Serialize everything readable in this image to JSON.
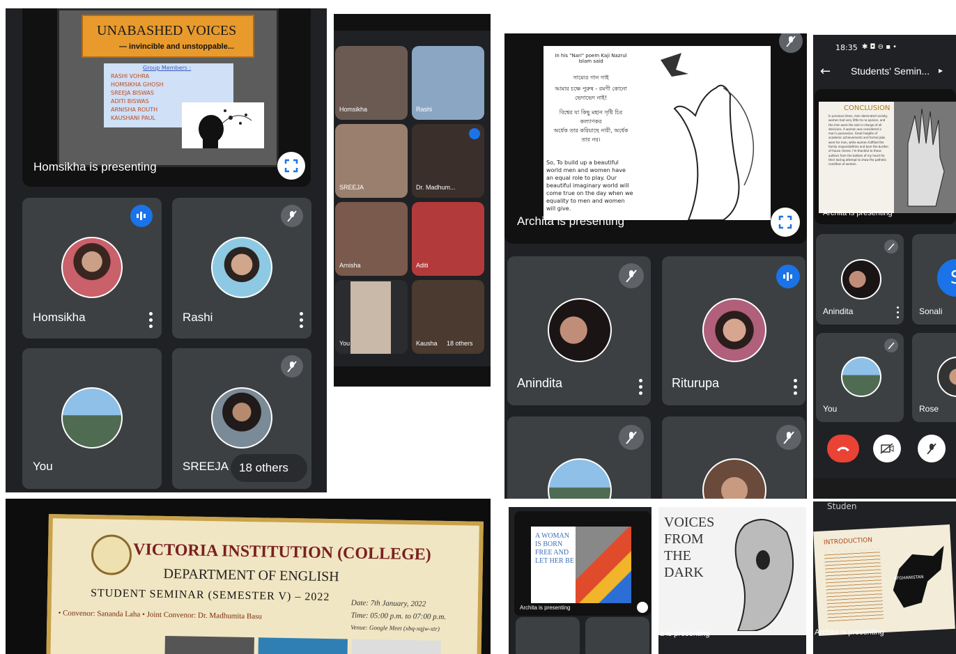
{
  "panel1": {
    "slide_title": "UNABASHED VOICES",
    "slide_subtitle": "— invincible and unstoppable...",
    "group_heading": "Group Members :",
    "members": [
      "RASHI VOHRA",
      "HOMSIKHA GHOSH",
      "SREEJA BISWAS",
      "ADITI BISWAS",
      "ARNISHA ROUTH",
      "KAUSHANI PAUL"
    ],
    "presenting": "Homsikha is presenting",
    "tiles": [
      "Homsikha",
      "Rashi",
      "You",
      "SREEJA"
    ],
    "others": "18 others"
  },
  "panel2": {
    "tiles": [
      "Homsikha",
      "Rashi",
      "SREEJA",
      "Dr. Madhum...",
      "Arnisha",
      "Aditi",
      "You",
      "Kausha"
    ],
    "others": "18 others"
  },
  "panel3": {
    "poem_intro": "In his \"Nari\" poem Kaji Nazrul Islam said",
    "bengali_1": "সাম্যের গান গাই",
    "bengali_2": "আমার চক্ষে পুরুষ - রমণী কোনো ভেদাভেদ নাই!",
    "bengali_3": "বিশ্বের যা কিছু মহান সৃষ্টি চির কল্যাণকর",
    "bengali_4": "অর্ধেক তার করিয়াছে নারী, অর্ধেক তার নর।",
    "poem_body": "So, To build up a beautiful world men and women have an equal role to play. Our beautiful imaginary world will come true on the day when we equality to men and women will give.",
    "presenting": "Archita is presenting",
    "tiles": [
      "Anindita",
      "Riturupa"
    ]
  },
  "panel4": {
    "time": "18:35",
    "title": "Students' Semin...",
    "slide_heading": "CONCLUSION",
    "slide_text": "In previous times, men dominated society, women had very little to no opinion, and the men were the sole in-charge of all decisions. A woman was considered a man's possession. Great heights of academic achievements and formal jobs were for men, while women fulfilled the family responsibilities and bore the burden of house chores. I'm thankful to these authors from the bottom of my heart for their daring attempt to show the pathetic condition of women.",
    "presenting": "Archita is presenting",
    "tiles": [
      "Anindita",
      "Sonali",
      "You",
      "Rose"
    ],
    "sonali_initial": "S"
  },
  "panel5": {
    "college": "VICTORIA INSTITUTION (COLLEGE)",
    "department": "DEPARTMENT OF ENGLISH",
    "seminar": "STUDENT SEMINAR (SEMESTER V) – 2022",
    "convenor": "• Convenor: Sananda Laha • Joint Convenor: Dr. Madhumita Basu",
    "date": "Date: 7th January, 2022",
    "time": "Time: 05:00 p.m. to 07:00 p.m.",
    "venue": "Venue: Google Meet (xbq-xqjw-xtr)"
  },
  "panel6": {
    "slide_text": "A WOMAN IS BORN FREE AND LET HER BE",
    "presenting": "Archita is presenting"
  },
  "panel7": {
    "title": "VOICES FROM THE DARK",
    "presenting": "a is presenting"
  },
  "panel8": {
    "header": "Studen",
    "slide_heading": "INTRODUCTION",
    "map_label": "AFGHANISTAN",
    "presenting": "Archita is presenting"
  },
  "colors": {
    "meet_bg": "#202124",
    "tile": "#3c4043",
    "accent_blue": "#1a73e8",
    "end_call": "#ea4335"
  }
}
